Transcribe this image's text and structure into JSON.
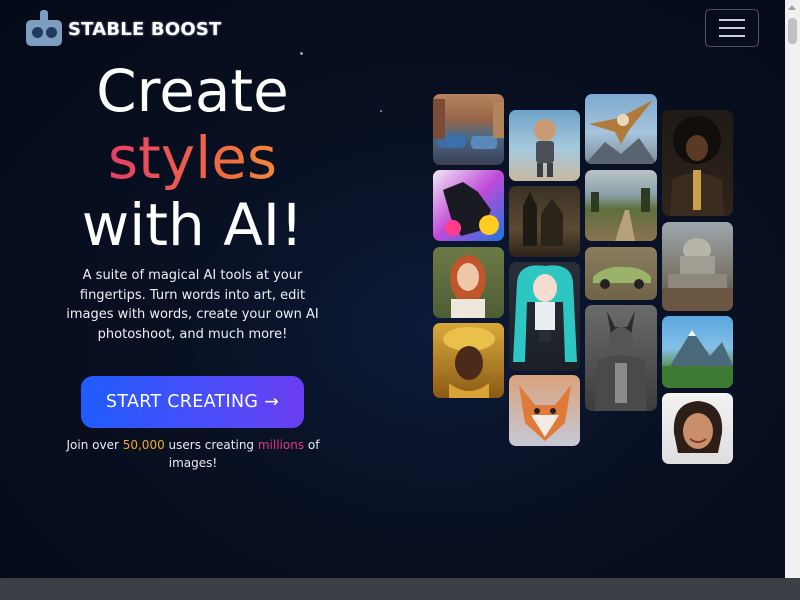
{
  "brand": {
    "name": "STABLE BOOST"
  },
  "nav": {
    "menu_icon": "hamburger-menu-icon"
  },
  "hero": {
    "title_line1": "Create",
    "title_line2": "styles",
    "title_line3": "with AI!",
    "tagline": "A suite of magical AI tools at your fingertips. Turn words into art, edit images with words, create your own AI photoshoot, and much more!",
    "cta_label": "START CREATING →",
    "join_prefix": "Join over ",
    "join_users": "50,000",
    "join_middle": " users creating ",
    "join_millions": "millions",
    "join_suffix": " of images!"
  },
  "gallery": {
    "images": [
      "street-cars-image",
      "dog-colorful-image",
      "red-hair-woman-image",
      "gold-jewelry-woman-image",
      "robot-boy-image",
      "castle-image",
      "anime-girl-image",
      "fox-image",
      "eagle-image",
      "country-road-image",
      "green-car-image",
      "armored-figure-image",
      "afro-man-suit-image",
      "ruined-capitol-image",
      "mountain-landscape-image",
      "smiling-woman-image"
    ]
  },
  "colors": {
    "accent_gradient_start": "#e3247d",
    "accent_gradient_end": "#f5b62d",
    "cta_start": "#1f5cff",
    "cta_end": "#6a3ef0"
  }
}
